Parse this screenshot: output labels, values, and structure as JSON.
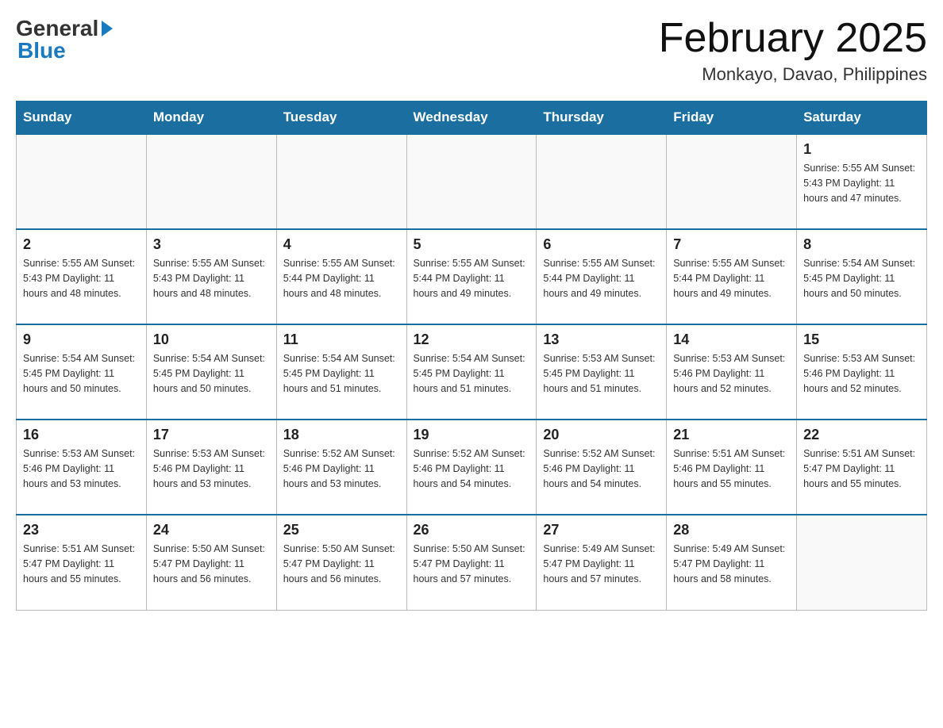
{
  "header": {
    "logo_text_general": "General",
    "logo_text_blue": "Blue",
    "month_title": "February 2025",
    "location": "Monkayo, Davao, Philippines"
  },
  "days_of_week": [
    "Sunday",
    "Monday",
    "Tuesday",
    "Wednesday",
    "Thursday",
    "Friday",
    "Saturday"
  ],
  "weeks": [
    {
      "days": [
        {
          "num": "",
          "info": ""
        },
        {
          "num": "",
          "info": ""
        },
        {
          "num": "",
          "info": ""
        },
        {
          "num": "",
          "info": ""
        },
        {
          "num": "",
          "info": ""
        },
        {
          "num": "",
          "info": ""
        },
        {
          "num": "1",
          "info": "Sunrise: 5:55 AM\nSunset: 5:43 PM\nDaylight: 11 hours\nand 47 minutes."
        }
      ]
    },
    {
      "days": [
        {
          "num": "2",
          "info": "Sunrise: 5:55 AM\nSunset: 5:43 PM\nDaylight: 11 hours\nand 48 minutes."
        },
        {
          "num": "3",
          "info": "Sunrise: 5:55 AM\nSunset: 5:43 PM\nDaylight: 11 hours\nand 48 minutes."
        },
        {
          "num": "4",
          "info": "Sunrise: 5:55 AM\nSunset: 5:44 PM\nDaylight: 11 hours\nand 48 minutes."
        },
        {
          "num": "5",
          "info": "Sunrise: 5:55 AM\nSunset: 5:44 PM\nDaylight: 11 hours\nand 49 minutes."
        },
        {
          "num": "6",
          "info": "Sunrise: 5:55 AM\nSunset: 5:44 PM\nDaylight: 11 hours\nand 49 minutes."
        },
        {
          "num": "7",
          "info": "Sunrise: 5:55 AM\nSunset: 5:44 PM\nDaylight: 11 hours\nand 49 minutes."
        },
        {
          "num": "8",
          "info": "Sunrise: 5:54 AM\nSunset: 5:45 PM\nDaylight: 11 hours\nand 50 minutes."
        }
      ]
    },
    {
      "days": [
        {
          "num": "9",
          "info": "Sunrise: 5:54 AM\nSunset: 5:45 PM\nDaylight: 11 hours\nand 50 minutes."
        },
        {
          "num": "10",
          "info": "Sunrise: 5:54 AM\nSunset: 5:45 PM\nDaylight: 11 hours\nand 50 minutes."
        },
        {
          "num": "11",
          "info": "Sunrise: 5:54 AM\nSunset: 5:45 PM\nDaylight: 11 hours\nand 51 minutes."
        },
        {
          "num": "12",
          "info": "Sunrise: 5:54 AM\nSunset: 5:45 PM\nDaylight: 11 hours\nand 51 minutes."
        },
        {
          "num": "13",
          "info": "Sunrise: 5:53 AM\nSunset: 5:45 PM\nDaylight: 11 hours\nand 51 minutes."
        },
        {
          "num": "14",
          "info": "Sunrise: 5:53 AM\nSunset: 5:46 PM\nDaylight: 11 hours\nand 52 minutes."
        },
        {
          "num": "15",
          "info": "Sunrise: 5:53 AM\nSunset: 5:46 PM\nDaylight: 11 hours\nand 52 minutes."
        }
      ]
    },
    {
      "days": [
        {
          "num": "16",
          "info": "Sunrise: 5:53 AM\nSunset: 5:46 PM\nDaylight: 11 hours\nand 53 minutes."
        },
        {
          "num": "17",
          "info": "Sunrise: 5:53 AM\nSunset: 5:46 PM\nDaylight: 11 hours\nand 53 minutes."
        },
        {
          "num": "18",
          "info": "Sunrise: 5:52 AM\nSunset: 5:46 PM\nDaylight: 11 hours\nand 53 minutes."
        },
        {
          "num": "19",
          "info": "Sunrise: 5:52 AM\nSunset: 5:46 PM\nDaylight: 11 hours\nand 54 minutes."
        },
        {
          "num": "20",
          "info": "Sunrise: 5:52 AM\nSunset: 5:46 PM\nDaylight: 11 hours\nand 54 minutes."
        },
        {
          "num": "21",
          "info": "Sunrise: 5:51 AM\nSunset: 5:46 PM\nDaylight: 11 hours\nand 55 minutes."
        },
        {
          "num": "22",
          "info": "Sunrise: 5:51 AM\nSunset: 5:47 PM\nDaylight: 11 hours\nand 55 minutes."
        }
      ]
    },
    {
      "days": [
        {
          "num": "23",
          "info": "Sunrise: 5:51 AM\nSunset: 5:47 PM\nDaylight: 11 hours\nand 55 minutes."
        },
        {
          "num": "24",
          "info": "Sunrise: 5:50 AM\nSunset: 5:47 PM\nDaylight: 11 hours\nand 56 minutes."
        },
        {
          "num": "25",
          "info": "Sunrise: 5:50 AM\nSunset: 5:47 PM\nDaylight: 11 hours\nand 56 minutes."
        },
        {
          "num": "26",
          "info": "Sunrise: 5:50 AM\nSunset: 5:47 PM\nDaylight: 11 hours\nand 57 minutes."
        },
        {
          "num": "27",
          "info": "Sunrise: 5:49 AM\nSunset: 5:47 PM\nDaylight: 11 hours\nand 57 minutes."
        },
        {
          "num": "28",
          "info": "Sunrise: 5:49 AM\nSunset: 5:47 PM\nDaylight: 11 hours\nand 58 minutes."
        },
        {
          "num": "",
          "info": ""
        }
      ]
    }
  ]
}
